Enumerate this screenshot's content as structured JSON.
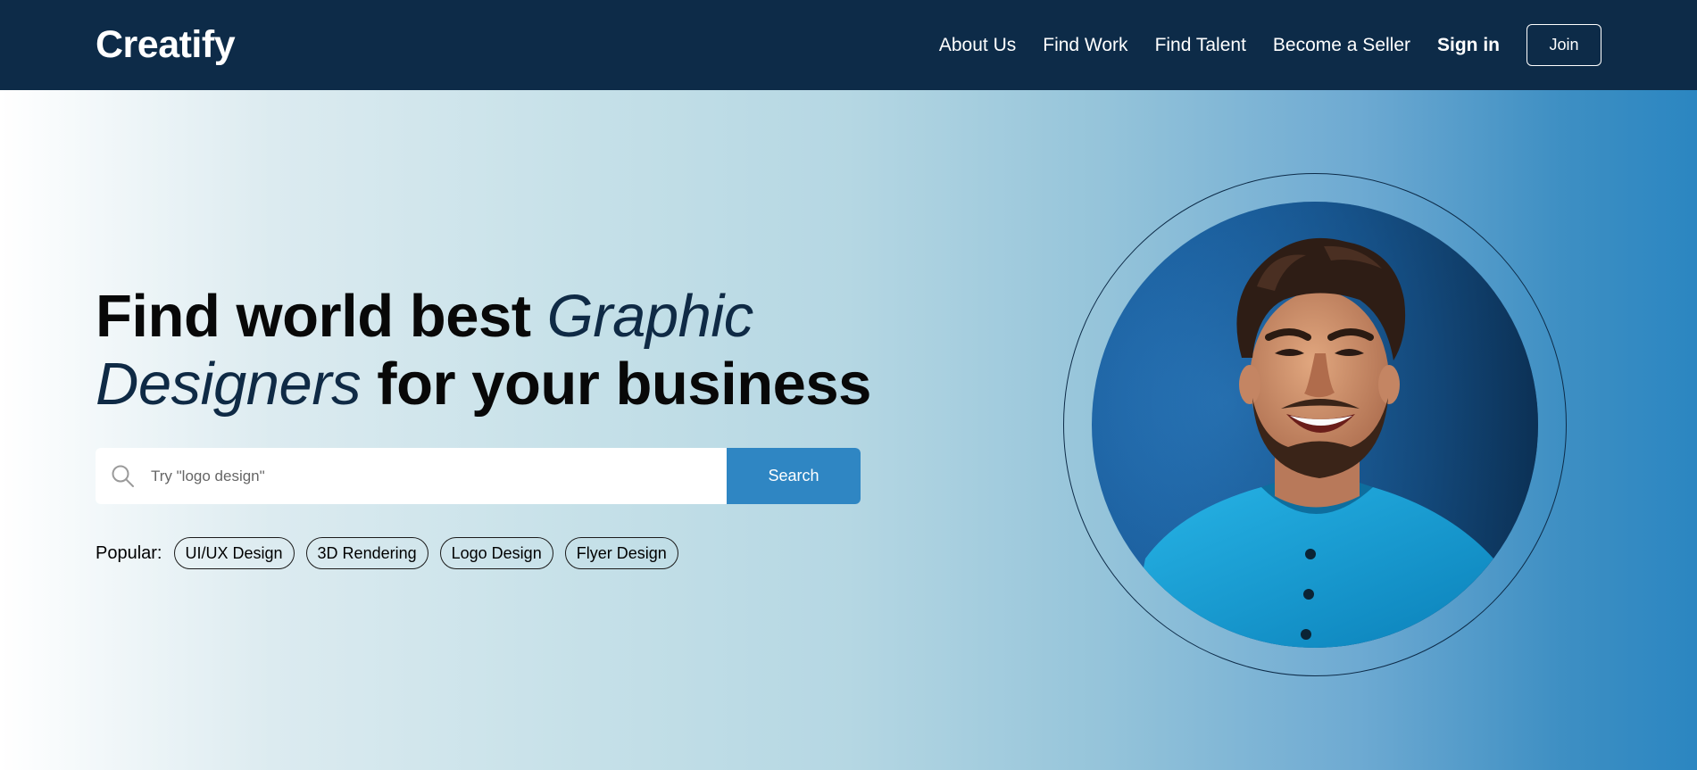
{
  "brand": {
    "name": "Creatify"
  },
  "nav": {
    "links": [
      "About Us",
      "Find Work",
      "Find Talent",
      "Become a Seller"
    ],
    "signin": "Sign in",
    "join": "Join"
  },
  "hero": {
    "headline": {
      "part1": "Find world best ",
      "italic1": "Graphic",
      "italic2": "Designers",
      "part2": " for your business"
    },
    "search": {
      "placeholder": "Try \"logo design\"",
      "button": "Search"
    },
    "popular": {
      "label": "Popular:",
      "tags": [
        "UI/UX Design",
        "3D Rendering",
        "Logo Design",
        "Flyer Design"
      ]
    }
  },
  "colors": {
    "navbar": "#0d2b48",
    "accent": "#2f86c3",
    "headline_italic": "#0f2a45"
  },
  "icons": {
    "search": "search-icon"
  }
}
